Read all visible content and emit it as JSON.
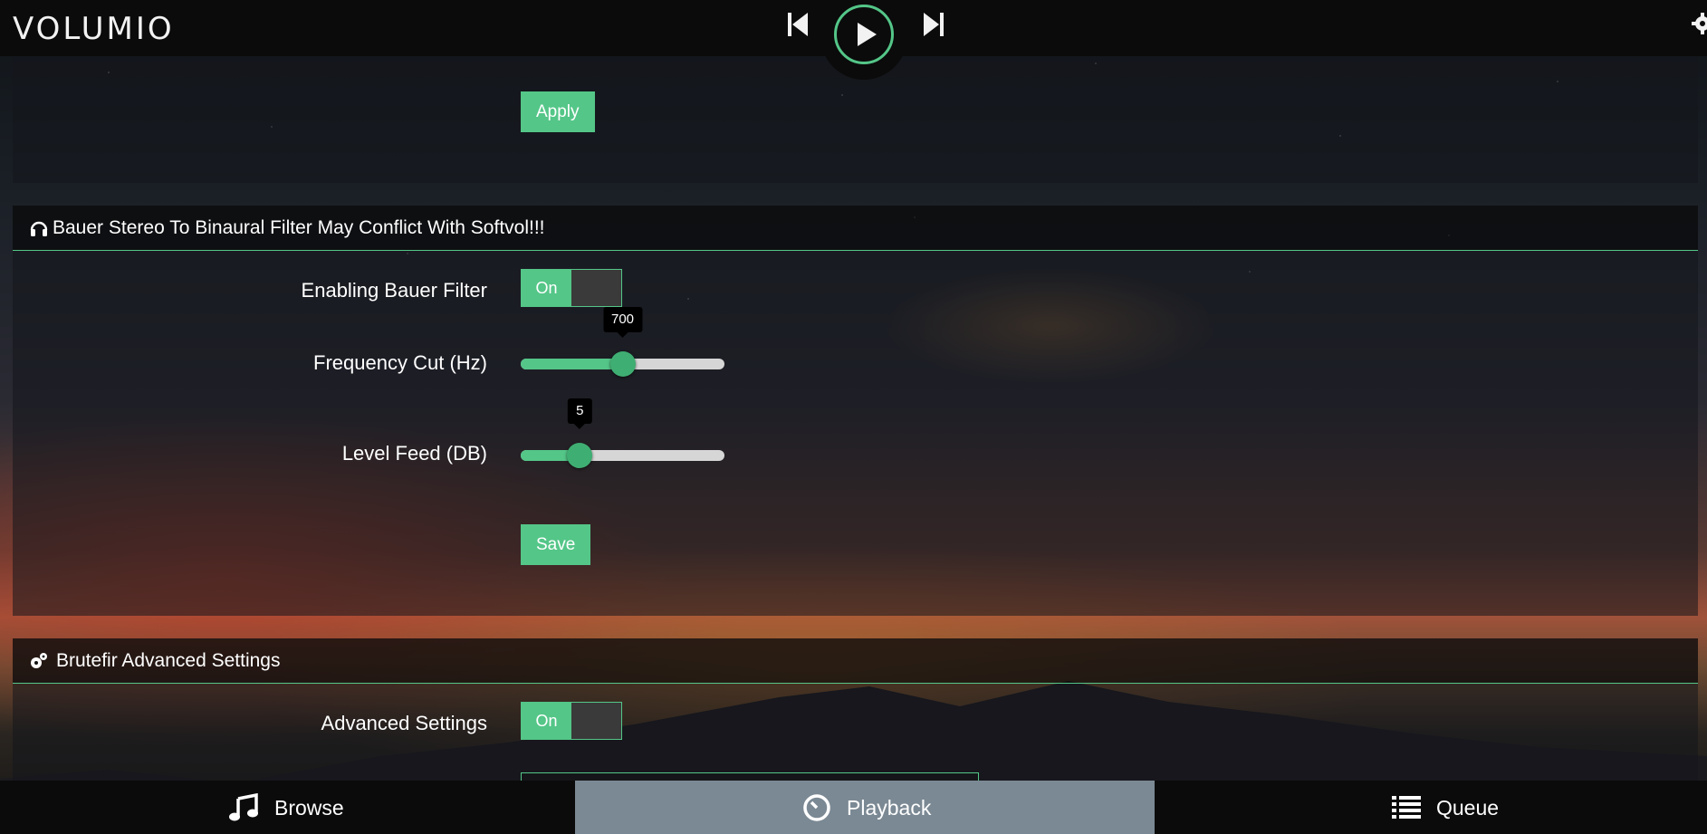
{
  "app": {
    "logo_text": "VOLUMIO",
    "accent_color": "#54c688"
  },
  "player": {
    "prev_icon": "skip-previous-icon",
    "play_icon": "play-icon",
    "next_icon": "skip-next-icon",
    "settings_icon": "gear-icon"
  },
  "section_prev": {
    "apply_label": "Apply"
  },
  "bauer": {
    "icon": "headphones-icon",
    "title": "Bauer Stereo To Binaural Filter May Conflict With Softvol!!!",
    "enable_label": "Enabling Bauer Filter",
    "enable_state": "On",
    "freq_label": "Frequency Cut (Hz)",
    "freq_value": "700",
    "freq_fraction": 0.5,
    "level_label": "Level Feed (DB)",
    "level_value": "5",
    "level_fraction": 0.29,
    "save_label": "Save"
  },
  "brutefir": {
    "icon": "gears-icon",
    "title": "Brutefir Advanced Settings",
    "advanced_label": "Advanced Settings",
    "advanced_state": "On"
  },
  "nav": {
    "browse_label": "Browse",
    "browse_icon": "music-note-icon",
    "playback_label": "Playback",
    "playback_icon": "clock-icon",
    "queue_label": "Queue",
    "queue_icon": "list-icon"
  }
}
